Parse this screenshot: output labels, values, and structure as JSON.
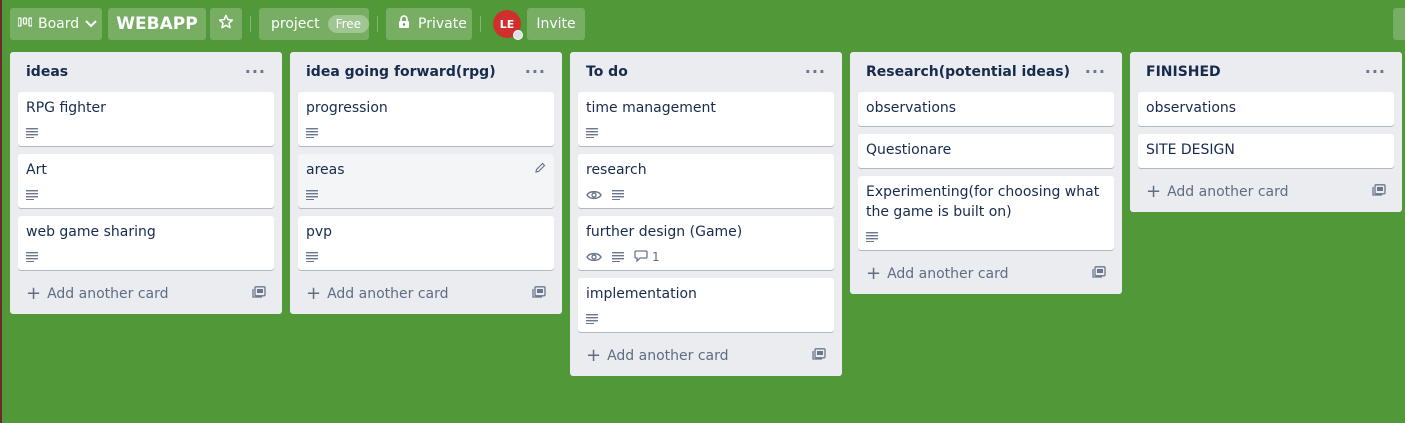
{
  "header": {
    "board_label": "Board",
    "title": "WEBAPP",
    "workspace_label": "project",
    "workspace_badge": "Free",
    "visibility_label": "Private",
    "avatar_initials": "LE",
    "invite_label": "Invite"
  },
  "colors": {
    "background": "#519839",
    "list": "#ebecf0",
    "card": "#ffffff",
    "avatar": "#d0302c"
  },
  "add_card_label": "Add another card",
  "lists": [
    {
      "title": "ideas",
      "cards": [
        {
          "title": "RPG fighter",
          "description": true
        },
        {
          "title": "Art",
          "description": true
        },
        {
          "title": "web game sharing",
          "description": true
        }
      ]
    },
    {
      "title": "idea going forward(rpg)",
      "cards": [
        {
          "title": "progression",
          "description": true
        },
        {
          "title": "areas",
          "description": true,
          "hovered": true
        },
        {
          "title": "pvp",
          "description": true
        }
      ]
    },
    {
      "title": "To do",
      "cards": [
        {
          "title": "time management",
          "description": true
        },
        {
          "title": "research",
          "watch": true,
          "description": true
        },
        {
          "title": "further design (Game)",
          "watch": true,
          "description": true,
          "comments": "1"
        },
        {
          "title": "implementation",
          "description": true
        }
      ]
    },
    {
      "title": "Research(potential ideas)",
      "cards": [
        {
          "title": "observations",
          "description": false
        },
        {
          "title": "Questionare",
          "description": false
        },
        {
          "title": "Experimenting(for choosing what the game is built on)",
          "description": true
        }
      ]
    },
    {
      "title": "FINISHED",
      "cards": [
        {
          "title": "observations",
          "description": false
        },
        {
          "title": "SITE DESIGN",
          "description": false
        }
      ]
    }
  ]
}
